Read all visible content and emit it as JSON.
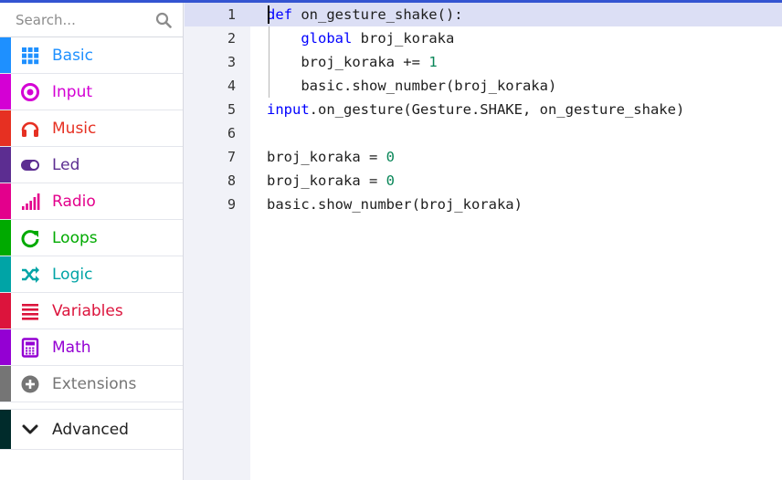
{
  "search": {
    "placeholder": "Search..."
  },
  "toolbox": {
    "categories": [
      {
        "label": "Basic",
        "color": "#1e90ff",
        "icon": "grid-icon"
      },
      {
        "label": "Input",
        "color": "#d400d4",
        "icon": "target-icon"
      },
      {
        "label": "Music",
        "color": "#e63022",
        "icon": "headphones-icon"
      },
      {
        "label": "Led",
        "color": "#5c2d91",
        "icon": "toggle-icon"
      },
      {
        "label": "Radio",
        "color": "#e3008c",
        "icon": "signal-bars-icon"
      },
      {
        "label": "Loops",
        "color": "#00aa00",
        "icon": "refresh-icon"
      },
      {
        "label": "Logic",
        "color": "#00a4a6",
        "icon": "shuffle-icon"
      },
      {
        "label": "Variables",
        "color": "#dc143c",
        "icon": "list-icon"
      },
      {
        "label": "Math",
        "color": "#9400d3",
        "icon": "calculator-icon"
      },
      {
        "label": "Extensions",
        "color": "#757575",
        "icon": "plus-circle-icon"
      }
    ],
    "advanced": {
      "label": "Advanced",
      "color": "#002b2b",
      "icon": "chevron-down-icon"
    }
  },
  "editor": {
    "line_numbers": [
      "1",
      "2",
      "3",
      "4",
      "5",
      "6",
      "7",
      "8",
      "9"
    ],
    "lines": [
      [
        {
          "t": "def",
          "k": "kw"
        },
        {
          "t": " on_gesture_shake():"
        }
      ],
      [
        {
          "t": "    "
        },
        {
          "t": "global",
          "k": "kw"
        },
        {
          "t": " broj_koraka"
        }
      ],
      [
        {
          "t": "    broj_koraka += "
        },
        {
          "t": "1",
          "k": "num"
        }
      ],
      [
        {
          "t": "    basic.show_number(broj_koraka)"
        }
      ],
      [
        {
          "t": "input",
          "k": "kw"
        },
        {
          "t": ".on_gesture(Gesture.SHAKE, on_gesture_shake)"
        }
      ],
      [],
      [
        {
          "t": "broj_koraka = "
        },
        {
          "t": "0",
          "k": "num"
        }
      ],
      [
        {
          "t": "broj_koraka = "
        },
        {
          "t": "0",
          "k": "num"
        }
      ],
      [
        {
          "t": "basic.show_number(broj_koraka)"
        }
      ]
    ]
  }
}
